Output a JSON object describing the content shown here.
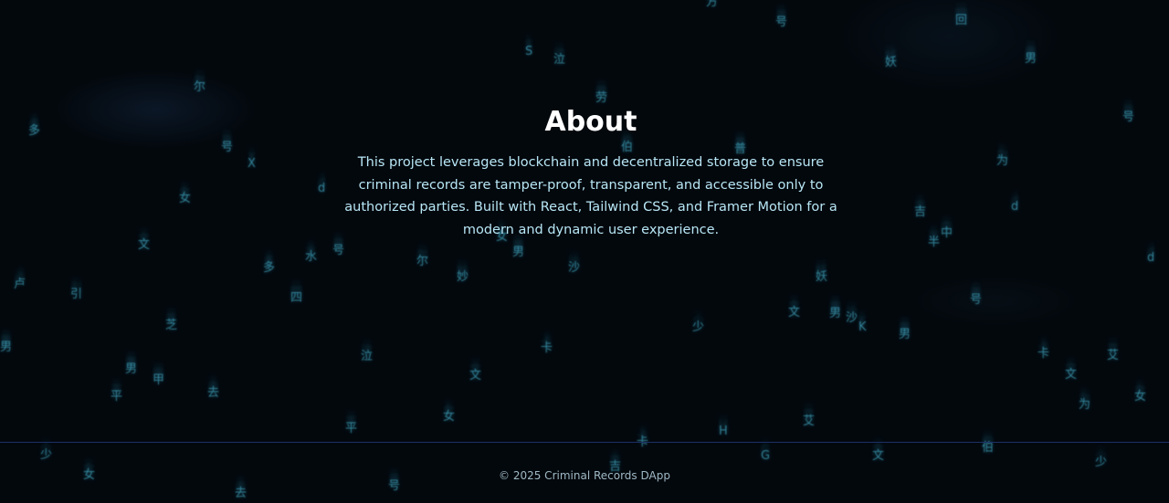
{
  "about": {
    "title": "About",
    "description": "This project leverages blockchain and decentralized storage to ensure criminal records are tamper-proof, transparent, and accessible only to authorized parties. Built with React, Tailwind CSS, and Framer Motion for a modern and dynamic user experience."
  },
  "footer": {
    "copyright": "© 2025 Criminal Records DApp"
  },
  "theme": {
    "background": "#03080d",
    "heading": "#ffffff",
    "body_text": "#b8e6f5",
    "footer_text": "#9fb8c4",
    "divider": "#1d2f66",
    "glyph": "#50c8e6"
  }
}
